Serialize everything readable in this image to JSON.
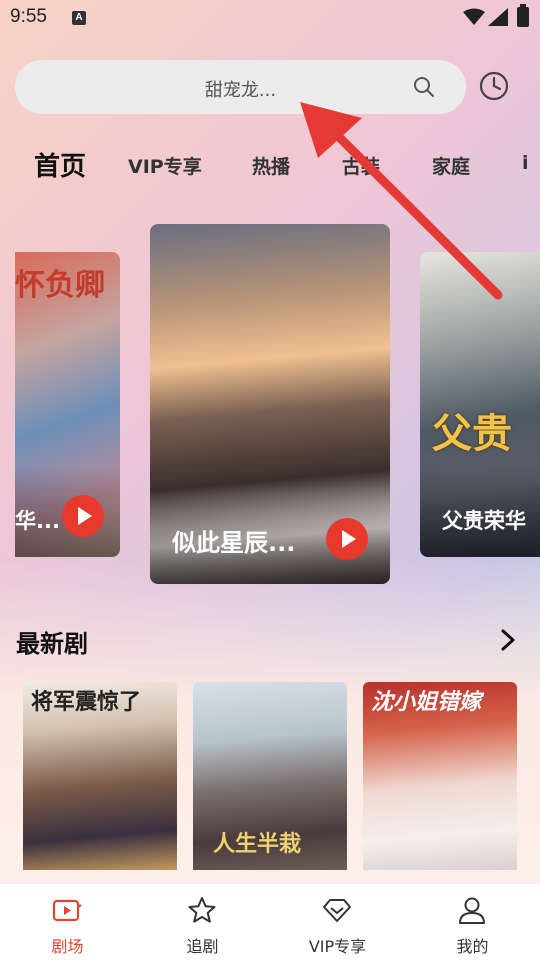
{
  "status": {
    "time": "9:55",
    "notification_icon": "A"
  },
  "search": {
    "placeholder": "甜宠龙..."
  },
  "tabs": [
    "首页",
    "VIP专享",
    "热播",
    "古装",
    "家庭",
    "i"
  ],
  "featured": [
    {
      "title": "华...",
      "deco": "怀负卿",
      "side": "left"
    },
    {
      "title": "似此星辰...",
      "side": "center"
    },
    {
      "title": "父贵荣华",
      "deco": "父贵",
      "side": "right"
    }
  ],
  "section": {
    "title": "最新剧"
  },
  "posters": [
    {
      "text": "将军震惊了"
    },
    {
      "text": "人生半栽"
    },
    {
      "text": "沈小姐错嫁"
    }
  ],
  "bottom_nav": [
    {
      "label": "剧场",
      "icon": "theater-icon",
      "active": true
    },
    {
      "label": "追剧",
      "icon": "star-icon",
      "active": false
    },
    {
      "label": "VIP专享",
      "icon": "diamond-icon",
      "active": false
    },
    {
      "label": "我的",
      "icon": "person-icon",
      "active": false
    }
  ],
  "colors": {
    "accent": "#e2452f",
    "play": "#e8392d",
    "arrow": "#e53935"
  }
}
